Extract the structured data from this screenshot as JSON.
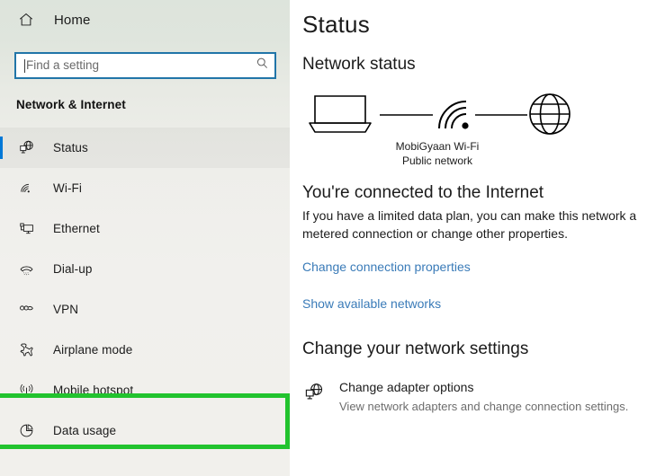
{
  "sidebar": {
    "home": {
      "label": "Home",
      "icon": "home-icon"
    },
    "search": {
      "value": "",
      "placeholder": "Find a setting",
      "icon": "search-icon"
    },
    "section_title": "Network & Internet",
    "items": [
      {
        "label": "Status",
        "icon": "globe-monitor-icon",
        "selected": true
      },
      {
        "label": "Wi-Fi",
        "icon": "wifi-icon",
        "selected": false
      },
      {
        "label": "Ethernet",
        "icon": "ethernet-icon",
        "selected": false
      },
      {
        "label": "Dial-up",
        "icon": "telephone-icon",
        "selected": false
      },
      {
        "label": "VPN",
        "icon": "vpn-icon",
        "selected": false
      },
      {
        "label": "Airplane mode",
        "icon": "airplane-icon",
        "selected": false
      },
      {
        "label": "Mobile hotspot",
        "icon": "hotspot-icon",
        "selected": false
      },
      {
        "label": "Data usage",
        "icon": "pie-chart-icon",
        "selected": false
      }
    ],
    "highlight": {
      "target": "Mobile hotspot",
      "color": "#22c32e"
    }
  },
  "main": {
    "page_title": "Status",
    "network_status_heading": "Network status",
    "diagram": {
      "device_icon": "laptop-icon",
      "connection_icon": "wifi-icon",
      "internet_icon": "globe-icon",
      "network_name": "MobiGyaan Wi-Fi",
      "network_type": "Public network"
    },
    "connected_heading": "You're connected to the Internet",
    "connected_description": "If you have a limited data plan, you can make this network a metered connection or change other properties.",
    "links": [
      "Change connection properties",
      "Show available networks"
    ],
    "change_settings_heading": "Change your network settings",
    "settings": [
      {
        "icon": "globe-monitor-icon",
        "title": "Change adapter options",
        "subtitle": "View network adapters and change connection settings."
      }
    ]
  },
  "colors": {
    "accent_blue": "#0078d7",
    "link_blue": "#3a7bb8",
    "search_border": "#2175a8",
    "highlight_green": "#22c32e"
  }
}
